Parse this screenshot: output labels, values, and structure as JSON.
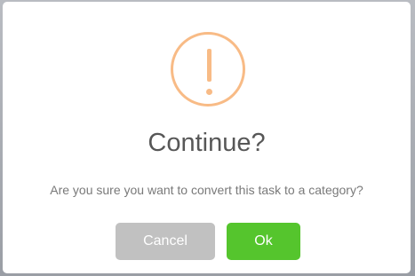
{
  "dialog": {
    "icon": "warning-icon",
    "title": "Continue?",
    "message": "Are you sure you want to convert this task to a category?",
    "cancel_label": "Cancel",
    "ok_label": "Ok"
  },
  "colors": {
    "warning": "#f8bb86",
    "ok_button": "#55c52d",
    "cancel_button": "#c1c1c1"
  }
}
